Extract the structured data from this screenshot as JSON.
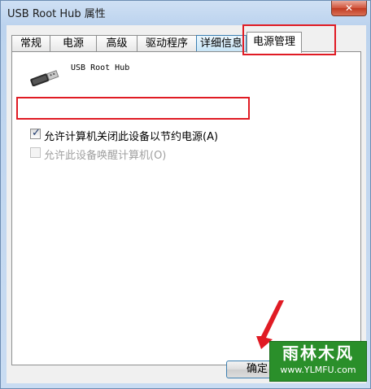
{
  "window": {
    "title": "USB Root Hub 属性",
    "close_glyph": "✕"
  },
  "tabs": [
    {
      "label": "常规"
    },
    {
      "label": "电源"
    },
    {
      "label": "高级"
    },
    {
      "label": "驱动程序"
    },
    {
      "label": "详细信息"
    },
    {
      "label": "电源管理",
      "active": true
    }
  ],
  "device": {
    "name": "USB Root Hub",
    "icon": "usb-connector-icon"
  },
  "options": [
    {
      "label": "允许计算机关闭此设备以节约电源(A)",
      "checked": true,
      "enabled": true
    },
    {
      "label": "允许此设备唤醒计算机(O)",
      "checked": false,
      "enabled": false
    }
  ],
  "buttons": {
    "ok": "确定"
  },
  "annotation_color": "#e01b24",
  "watermark": {
    "main": "雨林木风",
    "sub": "www.YLMFU.com"
  }
}
